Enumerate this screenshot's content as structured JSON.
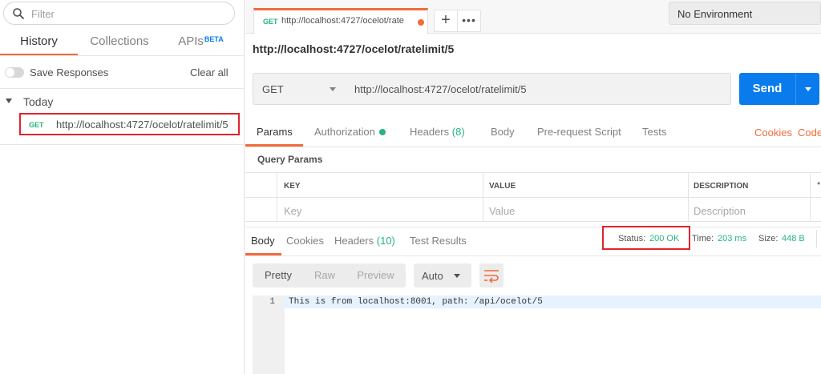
{
  "sidebar": {
    "filter_placeholder": "Filter",
    "tabs": {
      "history": "History",
      "collections": "Collections",
      "apis": "APIs",
      "apis_badge": "BETA"
    },
    "save_responses_label": "Save Responses",
    "clear_all_label": "Clear all",
    "group_label": "Today",
    "history_items": [
      {
        "method": "GET",
        "url": "http://localhost:4727/ocelot/ratelimit/5"
      }
    ]
  },
  "tabbar": {
    "request_tab": {
      "method": "GET",
      "url": "http://localhost:4727/ocelot/rate"
    },
    "add_icon_glyph": "+",
    "more_icon_glyph": "•••",
    "environment": "No Environment"
  },
  "request": {
    "name": "http://localhost:4727/ocelot/ratelimit/5",
    "method": "GET",
    "url": "http://localhost:4727/ocelot/ratelimit/5",
    "send_label": "Send",
    "tabs": {
      "params": "Params",
      "authorization": "Authorization",
      "headers": "Headers",
      "headers_count": "(8)",
      "body": "Body",
      "prerequest": "Pre-request Script",
      "tests": "Tests"
    },
    "cookies_link": "Cookies",
    "code_link": "Code",
    "query_params_title": "Query Params",
    "table_headers": {
      "key": "KEY",
      "value": "VALUE",
      "description": "DESCRIPTION"
    },
    "table_placeholders": {
      "key": "Key",
      "value": "Value",
      "description": "Description"
    }
  },
  "response": {
    "tabs": {
      "body": "Body",
      "cookies": "Cookies",
      "headers": "Headers",
      "headers_count": "(10)",
      "test_results": "Test Results"
    },
    "status_label": "Status:",
    "status_value": "200 OK",
    "time_label": "Time:",
    "time_value": "203 ms",
    "size_label": "Size:",
    "size_value": "448 B",
    "view_buttons": {
      "pretty": "Pretty",
      "raw": "Raw",
      "preview": "Preview"
    },
    "format": "Auto",
    "line_number": "1",
    "body_text": "This is from localhost:8001, path: /api/ocelot/5"
  },
  "colors": {
    "accent": "#f26b3a",
    "primary": "#097bed",
    "success": "#26b47f",
    "highlight_box": "#e0242c"
  }
}
